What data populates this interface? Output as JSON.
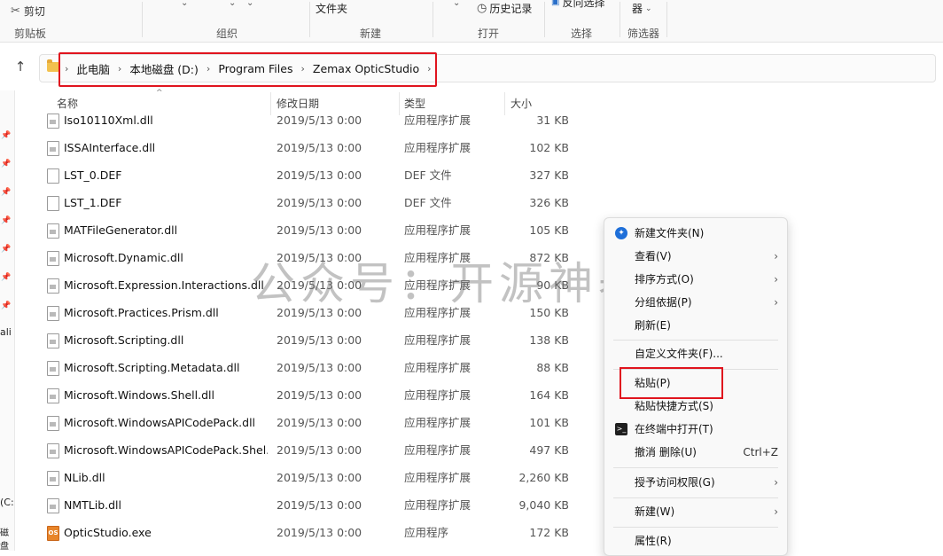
{
  "ribbon": {
    "cut_label": "剪切",
    "groups": [
      "剪贴板",
      "组织",
      "新建",
      "打开",
      "选择",
      "筛选器"
    ],
    "new_folder_label": "文件夹",
    "history_label": "历史记录",
    "invert_select_label": "反向选择",
    "filter_fragment": "器"
  },
  "address": {
    "crumbs": [
      "此电脑",
      "本地磁盘 (D:)",
      "Program Files",
      "Zemax OpticStudio"
    ]
  },
  "columns": {
    "name": "名称",
    "date": "修改日期",
    "type": "类型",
    "size": "大小"
  },
  "left_nav": {
    "frag_ali": "ali",
    "frag_c": "(C:",
    "frag_disk": "磁盘"
  },
  "files": [
    {
      "name": "Iso10110Xml.dll",
      "date": "2019/5/13 0:00",
      "type": "应用程序扩展",
      "size": "31 KB",
      "icon": "dll"
    },
    {
      "name": "ISSAInterface.dll",
      "date": "2019/5/13 0:00",
      "type": "应用程序扩展",
      "size": "102 KB",
      "icon": "dll"
    },
    {
      "name": "LST_0.DEF",
      "date": "2019/5/13 0:00",
      "type": "DEF 文件",
      "size": "327 KB",
      "icon": "file"
    },
    {
      "name": "LST_1.DEF",
      "date": "2019/5/13 0:00",
      "type": "DEF 文件",
      "size": "326 KB",
      "icon": "file"
    },
    {
      "name": "MATFileGenerator.dll",
      "date": "2019/5/13 0:00",
      "type": "应用程序扩展",
      "size": "105 KB",
      "icon": "dll"
    },
    {
      "name": "Microsoft.Dynamic.dll",
      "date": "2019/5/13 0:00",
      "type": "应用程序扩展",
      "size": "872 KB",
      "icon": "dll"
    },
    {
      "name": "Microsoft.Expression.Interactions.dll",
      "date": "2019/5/13 0:00",
      "type": "应用程序扩展",
      "size": "90 KB",
      "icon": "dll"
    },
    {
      "name": "Microsoft.Practices.Prism.dll",
      "date": "2019/5/13 0:00",
      "type": "应用程序扩展",
      "size": "150 KB",
      "icon": "dll"
    },
    {
      "name": "Microsoft.Scripting.dll",
      "date": "2019/5/13 0:00",
      "type": "应用程序扩展",
      "size": "138 KB",
      "icon": "dll"
    },
    {
      "name": "Microsoft.Scripting.Metadata.dll",
      "date": "2019/5/13 0:00",
      "type": "应用程序扩展",
      "size": "88 KB",
      "icon": "dll"
    },
    {
      "name": "Microsoft.Windows.Shell.dll",
      "date": "2019/5/13 0:00",
      "type": "应用程序扩展",
      "size": "164 KB",
      "icon": "dll"
    },
    {
      "name": "Microsoft.WindowsAPICodePack.dll",
      "date": "2019/5/13 0:00",
      "type": "应用程序扩展",
      "size": "101 KB",
      "icon": "dll"
    },
    {
      "name": "Microsoft.WindowsAPICodePack.Shel...",
      "date": "2019/5/13 0:00",
      "type": "应用程序扩展",
      "size": "497 KB",
      "icon": "dll"
    },
    {
      "name": "NLib.dll",
      "date": "2019/5/13 0:00",
      "type": "应用程序扩展",
      "size": "2,260 KB",
      "icon": "dll"
    },
    {
      "name": "NMTLib.dll",
      "date": "2019/5/13 0:00",
      "type": "应用程序扩展",
      "size": "9,040 KB",
      "icon": "dll"
    },
    {
      "name": "OpticStudio.exe",
      "date": "2019/5/13 0:00",
      "type": "应用程序",
      "size": "172 KB",
      "icon": "exe"
    }
  ],
  "context_menu": {
    "new_folder": "新建文件夹(N)",
    "view": "查看(V)",
    "sort": "排序方式(O)",
    "group": "分组依据(P)",
    "refresh": "刷新(E)",
    "customize": "自定义文件夹(F)...",
    "paste": "粘贴(P)",
    "paste_shortcut": "粘贴快捷方式(S)",
    "open_terminal": "在终端中打开(T)",
    "undo": "撤消 删除(U)",
    "undo_shortcut": "Ctrl+Z",
    "grant_access": "授予访问权限(G)",
    "new": "新建(W)",
    "properties": "属性(R)"
  },
  "watermark": "公众号：开源神器"
}
